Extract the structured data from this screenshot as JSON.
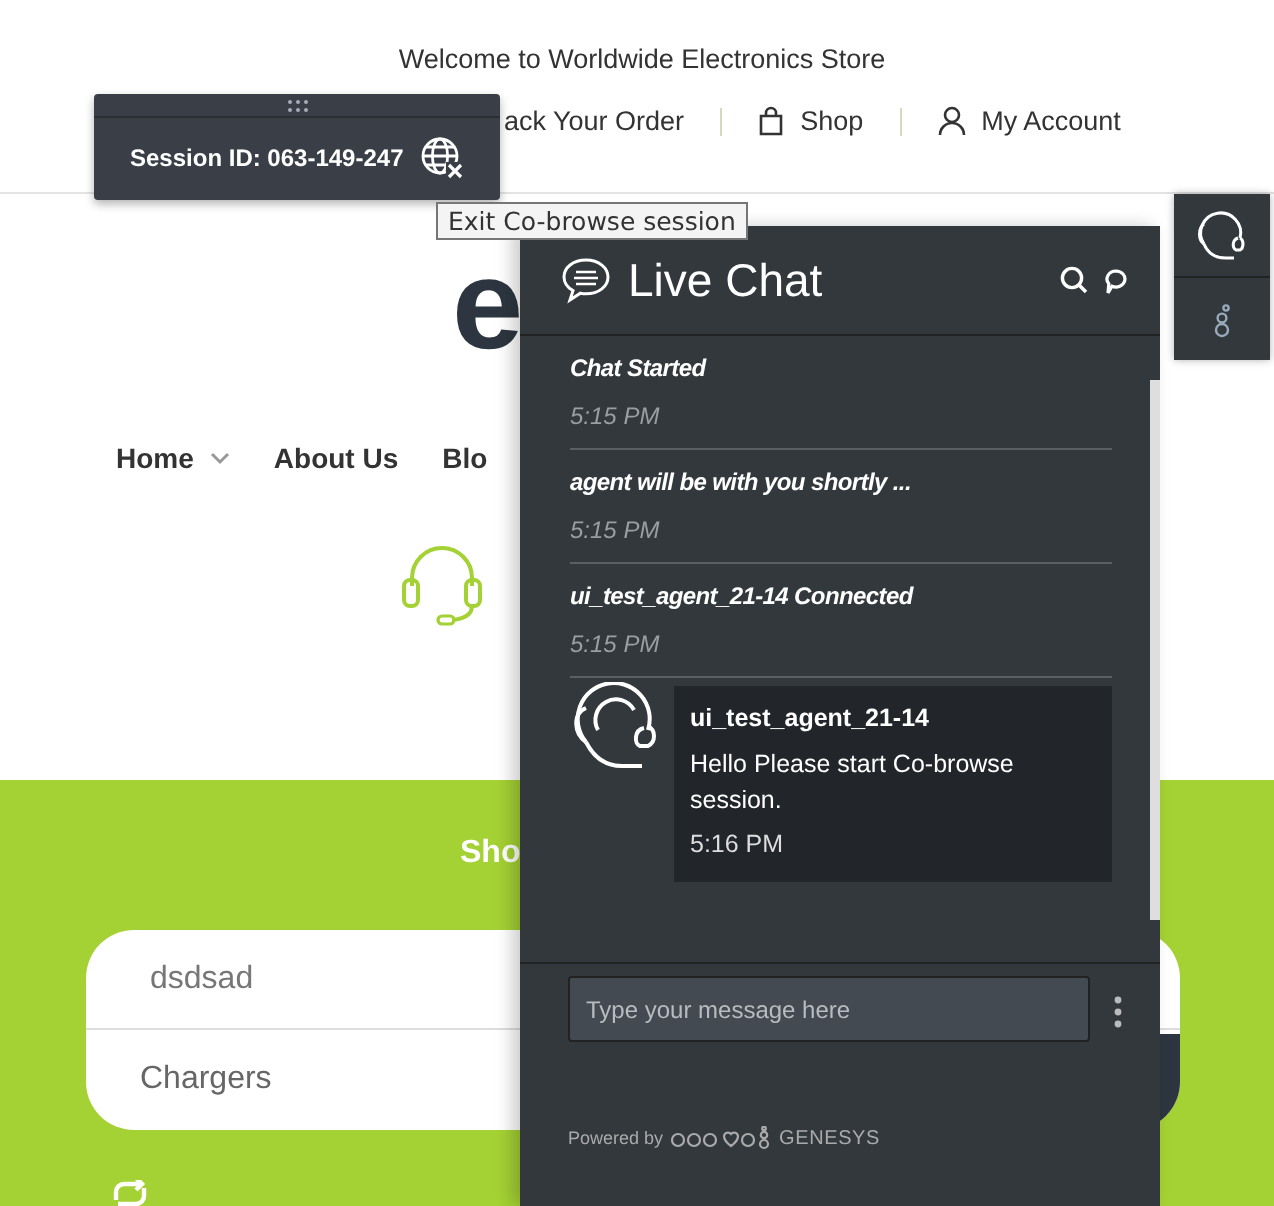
{
  "header": {
    "welcome": "Welcome to Worldwide Electronics Store",
    "links": [
      {
        "label": "ack Your Order"
      },
      {
        "label": "Shop"
      },
      {
        "label": "My Account"
      }
    ]
  },
  "logo": "e",
  "menu": [
    {
      "label": "Home",
      "dropdown": true
    },
    {
      "label": "About Us",
      "dropdown": false
    },
    {
      "label": "Blo",
      "dropdown": false
    }
  ],
  "band": {
    "heading": "Sho",
    "search": {
      "value": "dsdsad"
    },
    "category": "Chargers"
  },
  "cobrowse": {
    "session": "Session ID: 063-149-247",
    "tooltip": "Exit Co-browse session"
  },
  "chat": {
    "title": "Live Chat",
    "messages": [
      {
        "kind": "system",
        "text": "Chat Started",
        "time": "5:15 PM"
      },
      {
        "kind": "system",
        "text": "agent will be with you shortly ...",
        "time": "5:15 PM"
      },
      {
        "kind": "system",
        "text": "ui_test_agent_21-14 Connected",
        "time": "5:15 PM"
      },
      {
        "kind": "agent",
        "name": "ui_test_agent_21-14",
        "text": "Hello Please start Co-browse session.",
        "time": "5:16 PM"
      }
    ],
    "input": {
      "placeholder": "Type your message here"
    },
    "footer": {
      "powered": "Powered by",
      "brand": "GENESYS"
    }
  }
}
